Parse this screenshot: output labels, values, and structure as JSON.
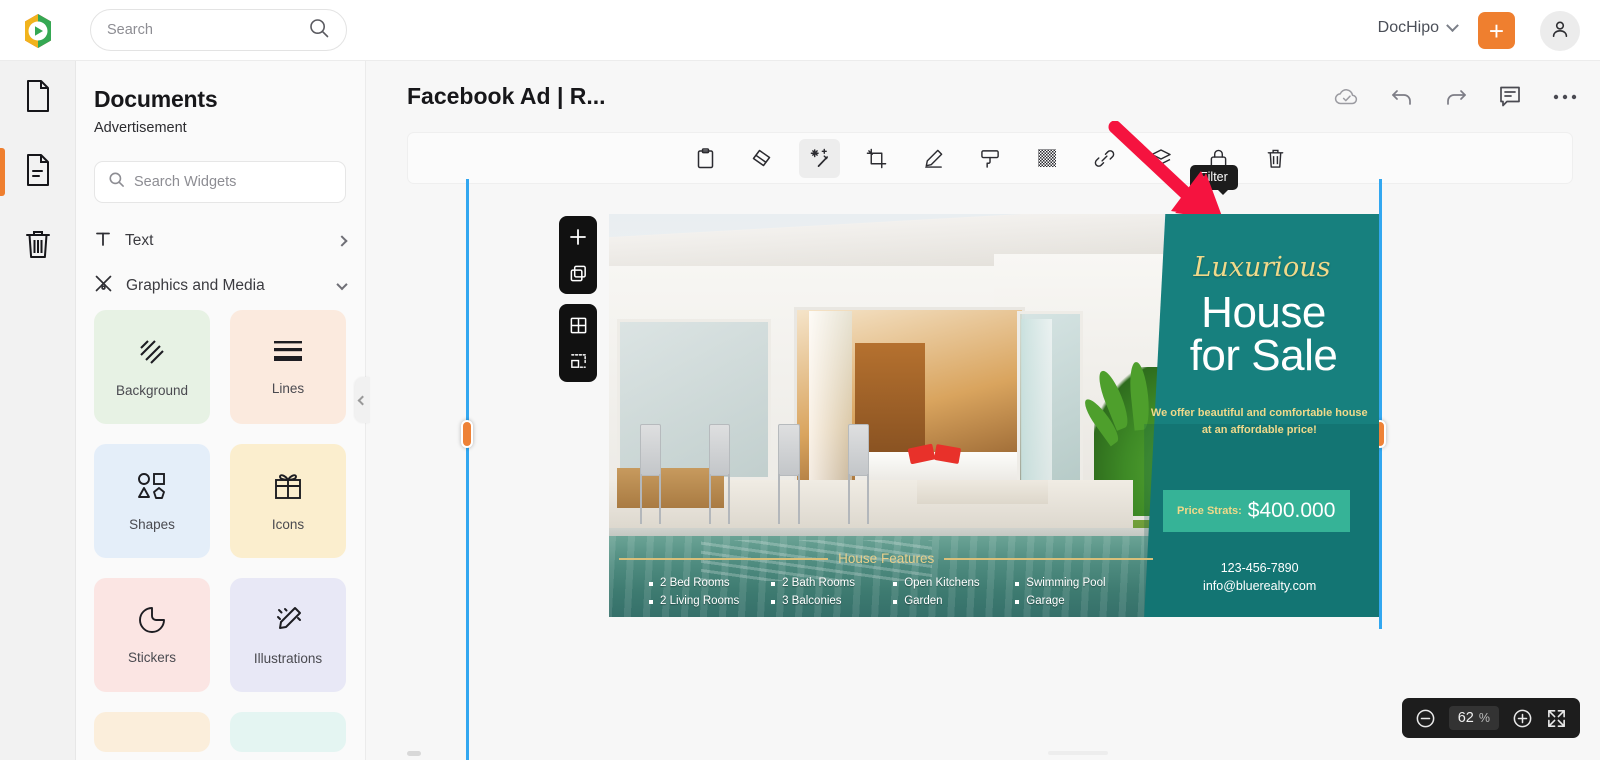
{
  "header": {
    "logo_icon": "dochipo-logo-icon",
    "search": {
      "placeholder": "Search",
      "value": "",
      "icon": "search-icon"
    },
    "brand_name": "DocHipo",
    "brand_chevron_icon": "chevron-down-icon",
    "create_button_icon": "plus-icon",
    "account_button_icon": "user-avatar-icon"
  },
  "rail": {
    "items": [
      {
        "name": "documents",
        "icon": "page-icon",
        "active": false
      },
      {
        "name": "pages",
        "icon": "page-lines-icon",
        "active": true
      },
      {
        "name": "trash",
        "icon": "trash-icon",
        "active": false
      }
    ]
  },
  "panel": {
    "title": "Documents",
    "subtitle": "Advertisement",
    "search": {
      "placeholder": "Search Widgets",
      "value": "",
      "icon": "search-icon"
    },
    "categories": [
      {
        "label": "Text",
        "icon": "text-t-icon",
        "chevron": "chevron-right-icon",
        "expanded": false
      },
      {
        "label": "Graphics and Media",
        "icon": "graphics-media-icon",
        "chevron": "chevron-down-icon",
        "expanded": true
      }
    ],
    "widgets": [
      {
        "label": "Background",
        "icon": "background-hatch-icon",
        "bg": "#e7f2e4"
      },
      {
        "label": "Lines",
        "icon": "lines-icon",
        "bg": "#fbeade"
      },
      {
        "label": "Shapes",
        "icon": "shapes-icon",
        "bg": "#e4eef9"
      },
      {
        "label": "Icons",
        "icon": "gift-icon",
        "bg": "#fbeece"
      },
      {
        "label": "Stickers",
        "icon": "sticker-icon",
        "bg": "#fbe5e3"
      },
      {
        "label": "Illustrations",
        "icon": "illustrations-pencil-icon",
        "bg": "#e8e8f6"
      },
      {
        "label": "",
        "icon": "widget-partial-icon",
        "bg": "#fbeedb"
      },
      {
        "label": "",
        "icon": "widget-partial-icon",
        "bg": "#e4f5f2"
      }
    ]
  },
  "canvas": {
    "document_title": "Facebook Ad | R...",
    "top_icons": [
      {
        "name": "cloud-saved-icon"
      },
      {
        "name": "undo-icon"
      },
      {
        "name": "redo-icon"
      },
      {
        "name": "comment-icon"
      },
      {
        "name": "more-options-icon"
      }
    ],
    "collapse_handle_icon": "chevron-left-icon",
    "object_toolbar": [
      {
        "name": "clipboard-icon",
        "label": "Clipboard",
        "active": false
      },
      {
        "name": "eraser-icon",
        "label": "Eraser",
        "active": false
      },
      {
        "name": "filter-icon",
        "label": "Filter",
        "active": true
      },
      {
        "name": "crop-icon",
        "label": "Crop",
        "active": false
      },
      {
        "name": "pen-icon",
        "label": "Pen",
        "active": false
      },
      {
        "name": "paint-roller-icon",
        "label": "Paint",
        "active": false
      },
      {
        "name": "transparency-icon",
        "label": "Transparency",
        "active": false
      },
      {
        "name": "link-icon",
        "label": "Link",
        "active": false
      },
      {
        "name": "layers-icon",
        "label": "Layers",
        "active": false
      },
      {
        "name": "lock-icon",
        "label": "Lock",
        "active": false
      },
      {
        "name": "delete-icon",
        "label": "Delete",
        "active": false
      }
    ],
    "tooltip": {
      "text": "Filter"
    },
    "float_tools": [
      {
        "name": "add-page-icon"
      },
      {
        "name": "duplicate-page-icon"
      },
      {
        "name": "grid-icon"
      },
      {
        "name": "crop-marks-icon"
      }
    ],
    "zoom": {
      "value": "62",
      "unit": "%",
      "minus_icon": "zoom-out-icon",
      "plus_icon": "zoom-in-icon",
      "fit_icon": "fit-screen-icon"
    },
    "guide_color": "#32a7f0",
    "handle_color": "#ee8237"
  },
  "design": {
    "script_title": "Luxurious",
    "headline_line1": "House",
    "headline_line2": "for Sale",
    "description": "We offer beautiful and comfortable house at an affordable price!",
    "price_label": "Price Strats:",
    "price_value": "$400.000",
    "phone": "123-456-7890",
    "email": "info@bluerealty.com",
    "features_title": "House Features",
    "features": [
      [
        "2 Bed Rooms",
        "2 Living Rooms"
      ],
      [
        "2 Bath Rooms",
        "3 Balconies"
      ],
      [
        "Open Kitchens",
        "Garden"
      ],
      [
        "Swimming Pool",
        "Garage"
      ]
    ],
    "colors": {
      "teal": "#17807e",
      "accent_gold": "#f0d98a",
      "price_badge": "#36b397",
      "white": "#ffffff"
    }
  }
}
